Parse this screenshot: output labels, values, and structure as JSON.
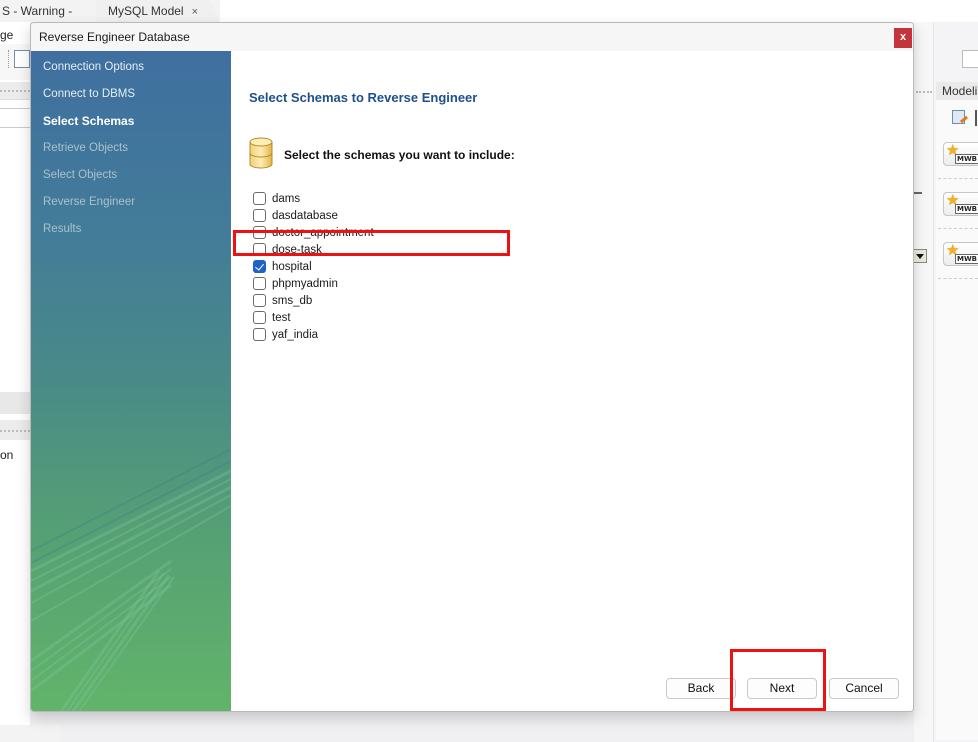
{
  "app_tabs": [
    {
      "label": "S - Warning - n..",
      "close": "×"
    },
    {
      "label": "MySQL Model",
      "close": "×"
    }
  ],
  "background": {
    "menu_fragment": "ge",
    "left_text_fragment": "on",
    "right_panel_title": "Modelin",
    "mwb_badges": [
      "MWB",
      "MWB",
      "MWB"
    ]
  },
  "dialog": {
    "title": "Reverse Engineer Database",
    "close_label": "x",
    "steps": [
      {
        "label": "Connection Options",
        "state": "done"
      },
      {
        "label": "Connect to DBMS",
        "state": "done"
      },
      {
        "label": "Select Schemas",
        "state": "active"
      },
      {
        "label": "Retrieve Objects",
        "state": "future"
      },
      {
        "label": "Select Objects",
        "state": "future"
      },
      {
        "label": "Reverse Engineer",
        "state": "future"
      },
      {
        "label": "Results",
        "state": "future"
      }
    ],
    "page_title": "Select Schemas to Reverse Engineer",
    "instruction": "Select the schemas you want to include:",
    "schemas": [
      {
        "name": "dams",
        "checked": false
      },
      {
        "name": "dasdatabase",
        "checked": false
      },
      {
        "name": "doctor_appointment",
        "checked": false
      },
      {
        "name": "dose-task",
        "checked": false
      },
      {
        "name": "hospital",
        "checked": true
      },
      {
        "name": "phpmyadmin",
        "checked": false
      },
      {
        "name": "sms_db",
        "checked": false
      },
      {
        "name": "test",
        "checked": false
      },
      {
        "name": "yaf_india",
        "checked": false
      }
    ],
    "buttons": {
      "back": "Back",
      "next": "Next",
      "cancel": "Cancel"
    }
  },
  "colors": {
    "title_blue": "#1f4f8d",
    "checkbox_blue": "#1f63c6",
    "close_red": "#c4343c",
    "highlight_red": "#ee1111"
  }
}
